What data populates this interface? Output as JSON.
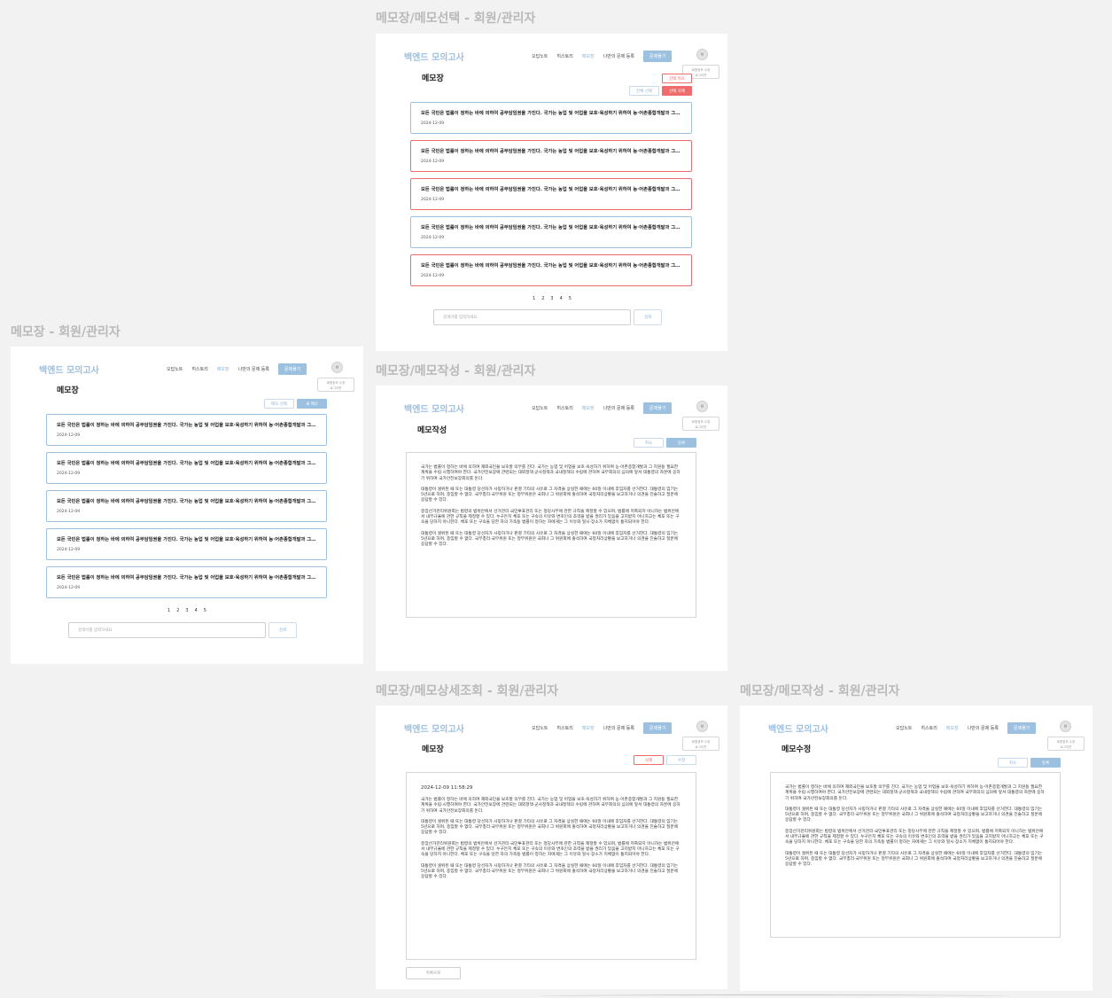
{
  "header": {
    "brand": "백엔드 모의고사",
    "nav": [
      "오답노트",
      "히스토리",
      "메모장",
      "나만의 문제 등록"
    ],
    "active_nav": "메모장",
    "cta": "문제풀기",
    "avatar": "M",
    "popover_line1": "회원정보 수정",
    "popover_line2": "로그아웃"
  },
  "memo": {
    "text": "모든 국민은 법률이 정하는 바에 의하여 공무담임권을 가진다. 국가는 농업 및 어업을 보호·육성하기 위하여 농·어촌종합개발과 그 지원등 필요한 계획을 수립·시행하여야 한다.",
    "date": "2024-12-09"
  },
  "pages": [
    "1",
    "2",
    "3",
    "4",
    "5"
  ],
  "search": {
    "placeholder": "검색어를 입력하세요",
    "button": "검색"
  },
  "content": {
    "p1": "국가는 법률이 정하는 바에 의하여 재외국민을 보호할 의무를 진다. 국가는 농업 및 어업을 보호·육성하기 위하여 농·어촌종합개발과 그 지원등 필요한 계획을 수립·시행하여야 한다. 국가안전보장에 관련되는 대외정책·군사정책과 국내정책의 수립에 관하여 국무회의의 심의에 앞서 대통령의 자문에 응하기 위하여 국가안전보장회의를 둔다.",
    "p2": "대통령이 궐위된 때 또는 대통령 당선자가 사망하거나 판결 기타의 사유로 그 자격을 상실한 때에는 60일 이내에 후임자를 선거한다. 대통령의 임기는 5년으로 하며, 중임할 수 없다. 국무총리·국무위원 또는 정부위원은 국회나 그 위원회에 출석하여 국정처리상황을 보고하거나 의견을 진술하고 질문에 응답할 수 있다.",
    "p3": "중앙선거관리위원회는 법령의 범위안에서 선거관리·국민투표관리 또는 정당사무에 관한 규칙을 제정할 수 있으며, 법률에 저촉되지 아니하는 범위안에서 내부규율에 관한 규칙을 제정할 수 있다. 누구든지 체포 또는 구속의 이유와 변호인의 조력을 받을 권리가 있음을 고지받지 아니하고는 체포 또는 구속을 당하지 아니한다. 체포 또는 구속을 당한 자의 가족등 법률이 정하는 자에게는 그 이유와 일시·장소가 지체없이 통지되어야 한다.",
    "p4": "대통령이 궐위된 때 또는 대통령 당선자가 사망하거나 판결 기타의 사유로 그 자격을 상실한 때에는 60일 이내에 후임자를 선거한다. 대통령의 임기는 5년으로 하며, 중임할 수 없다. 국무총리·국무위원 또는 정부위원은 국회나 그 위원회에 출석하여 국정처리상황을 보고하거나 의견을 진술하고 질문에 응답할 수 있다."
  },
  "frames": {
    "list": {
      "label": "메모장 - 회원/관리자",
      "title": "메모장",
      "select_btn": "메모 선택",
      "new_btn": "새 메모"
    },
    "select": {
      "label": "메모장/메모선택 - 회원/관리자",
      "title": "메모장",
      "cancel_btn": "선택 취소",
      "select_all_btn": "전체 선택",
      "delete_btn": "선택 삭제",
      "selected_rows": [
        false,
        true,
        true,
        false,
        true
      ]
    },
    "write": {
      "label": "메모장/메모작성 - 회원/관리자",
      "title": "메모작성",
      "cancel_btn": "취소",
      "save_btn": "등록"
    },
    "detail": {
      "label": "메모장/메모상세조회 - 회원/관리자",
      "title": "메모장",
      "delete_btn": "삭제",
      "edit_btn": "수정",
      "datetime": "2024-12-09 11:58:29",
      "back_btn": "목록으로"
    },
    "edit": {
      "label": "메모장/메모작성 - 회원/관리자",
      "title": "메모수정",
      "cancel_btn": "취소",
      "save_btn": "등록"
    }
  }
}
